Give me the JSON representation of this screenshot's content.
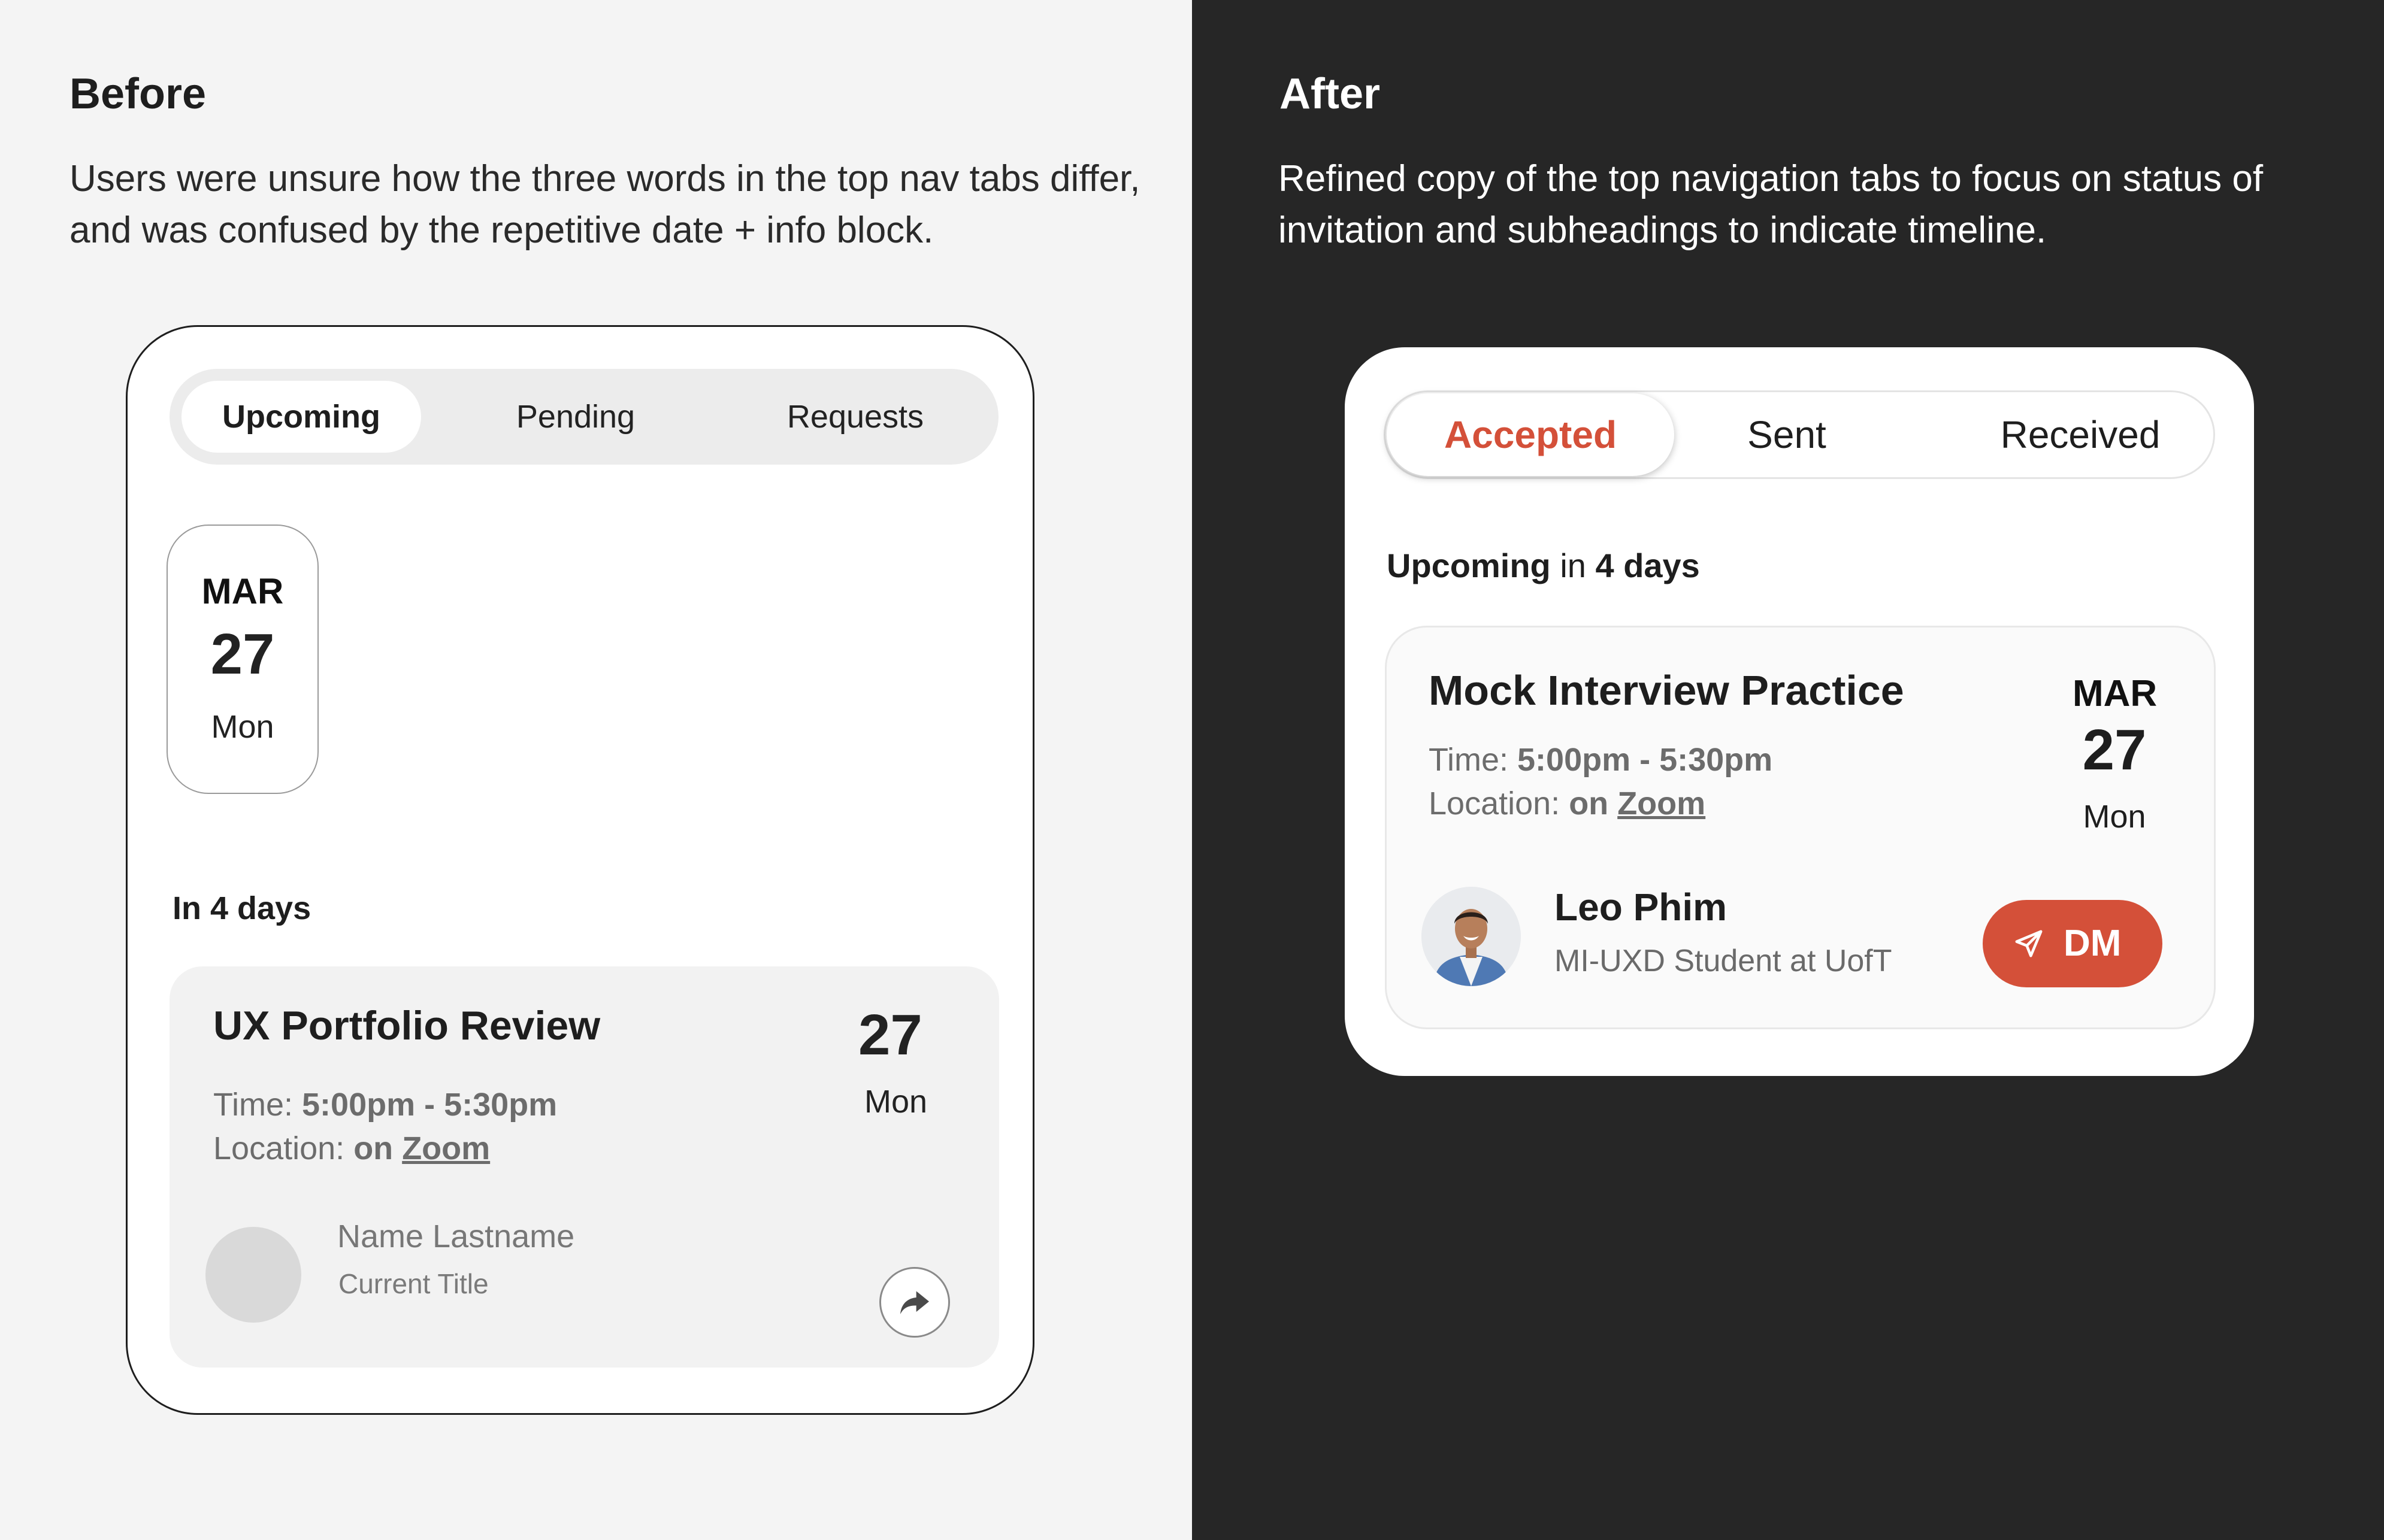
{
  "before": {
    "heading": "Before",
    "description": "Users were unsure how the three words in the top nav tabs differ, and was confused by the repetitive date + info block.",
    "tabs": [
      "Upcoming",
      "Pending",
      "Requests"
    ],
    "active_tab": "Upcoming",
    "date_card": {
      "month": "MAR",
      "day": "27",
      "weekday": "Mon"
    },
    "section_label": "In 4 days",
    "event": {
      "title": "UX Portfolio Review",
      "day": "27",
      "weekday": "Mon",
      "time_label": "Time:",
      "time_value": "5:00pm - 5:30pm",
      "location_label": "Location:",
      "location_on": "on",
      "location_value": "Zoom",
      "person_name": "Name Lastname",
      "person_title": "Current Title",
      "share_icon": "share-arrow-icon"
    }
  },
  "after": {
    "heading": "After",
    "description": "Refined copy of the top navigation tabs to focus on status of invitation and subheadings to indicate timeline.",
    "tabs": [
      "Accepted",
      "Sent",
      "Received"
    ],
    "active_tab": "Accepted",
    "subheading": {
      "status": "Upcoming",
      "mid": "in",
      "days": "4 days"
    },
    "event": {
      "title": "Mock Interview Practice",
      "month": "MAR",
      "day": "27",
      "weekday": "Mon",
      "time_label": "Time:",
      "time_value": "5:00pm - 5:30pm",
      "location_label": "Location:",
      "location_on": "on",
      "location_value": "Zoom",
      "person_name": "Leo Phim",
      "person_title": "MI-UXD Student at UofT",
      "dm_label": "DM",
      "dm_icon": "send-icon"
    }
  },
  "colors": {
    "accent": "#d45039",
    "left_bg": "#f4f4f4",
    "right_bg": "#262626"
  }
}
